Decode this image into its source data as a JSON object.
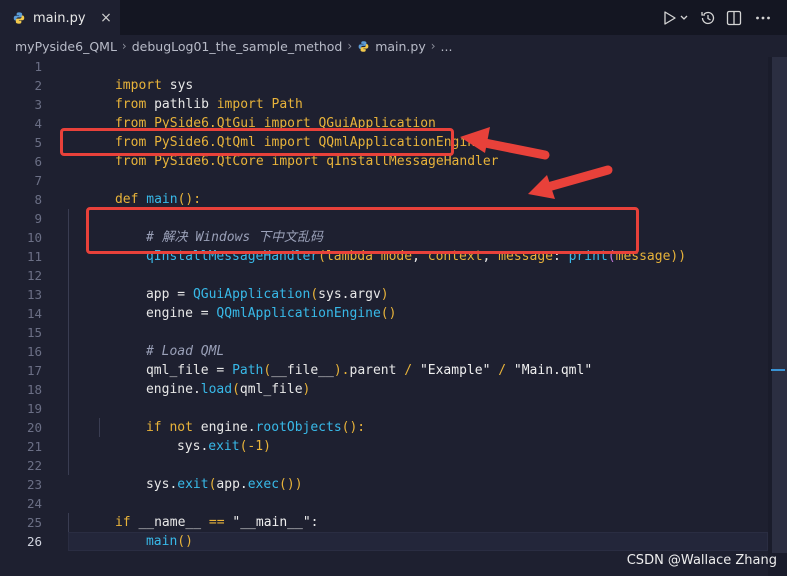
{
  "tab": {
    "filename": "main.py",
    "close": "×"
  },
  "breadcrumb": {
    "items": [
      "myPyside6_QML",
      "debugLog01_the_sample_method",
      "main.py",
      "..."
    ]
  },
  "editor": {
    "line_numbers": [
      "1",
      "2",
      "3",
      "4",
      "5",
      "6",
      "7",
      "8",
      "9",
      "10",
      "11",
      "12",
      "13",
      "14",
      "15",
      "16",
      "17",
      "18",
      "19",
      "20",
      "21",
      "22",
      "23",
      "24",
      "25",
      "26"
    ],
    "active_line": 26,
    "lines": {
      "l1": [
        "import",
        " sys"
      ],
      "l2": [
        "from",
        " pathlib ",
        "import",
        " Path"
      ],
      "l3": [
        "from",
        " PySide6.QtGui ",
        "import",
        " QGuiApplication"
      ],
      "l4": [
        "from",
        " PySide6.QtQml ",
        "import",
        " QQmlApplicationEngine"
      ],
      "l5": [
        "from",
        " PySide6.QtCore ",
        "import",
        " qInstallMessageHandler"
      ],
      "l7": [
        "def",
        " ",
        "main",
        "():"
      ],
      "l9": "# 解决 Windows 下中文乱码",
      "l10": [
        "qInstallMessageHandler",
        "(",
        "lambda",
        " ",
        "mode",
        ", ",
        "context",
        ", ",
        "message",
        ": ",
        "print",
        "(",
        "message",
        "))"
      ],
      "l12": [
        "app",
        " = ",
        "QGuiApplication",
        "(",
        "sys",
        ".",
        "argv",
        ")"
      ],
      "l13": [
        "engine",
        " = ",
        "QQmlApplicationEngine",
        "()"
      ],
      "l15": "# Load QML",
      "l16": [
        "qml_file",
        " = ",
        "Path",
        "(",
        "__file__",
        ").",
        "parent",
        " / ",
        "\"Example\"",
        " / ",
        "\"Main.qml\""
      ],
      "l17": [
        "engine",
        ".",
        "load",
        "(",
        "qml_file",
        ")"
      ],
      "l19": [
        "if",
        " ",
        "not",
        " ",
        "engine",
        ".",
        "rootObjects",
        "():"
      ],
      "l20": [
        "sys",
        ".",
        "exit",
        "(",
        "-1",
        ")"
      ],
      "l22": [
        "sys",
        ".",
        "exit",
        "(",
        "app",
        ".",
        "exec",
        "())"
      ],
      "l24": [
        "if",
        " __name__ ",
        "==",
        " ",
        "\"__main__\"",
        ":"
      ],
      "l25": [
        "main",
        "()"
      ]
    }
  },
  "watermark": "CSDN @Wallace Zhang",
  "colors": {
    "highlight_box": "#e8413a",
    "arrow": "#e8413a",
    "keyword": "#e8b33a",
    "function": "#38b9e8"
  }
}
